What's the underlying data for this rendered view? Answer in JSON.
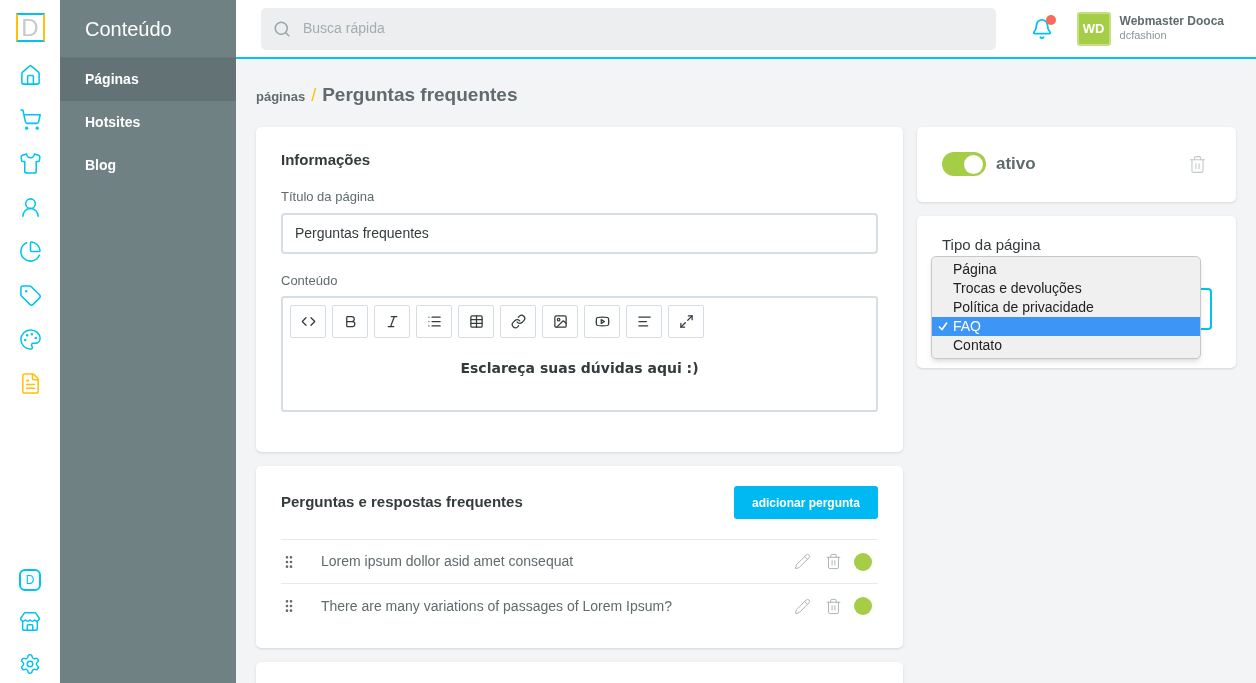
{
  "logo": {
    "letter": "D"
  },
  "rail": {
    "items": [
      {
        "kind": "home",
        "selected": false
      },
      {
        "kind": "cart",
        "selected": false
      },
      {
        "kind": "shirt",
        "selected": false
      },
      {
        "kind": "user",
        "selected": false
      },
      {
        "kind": "chart",
        "selected": false
      },
      {
        "kind": "tag",
        "selected": false
      },
      {
        "kind": "palette",
        "selected": false
      },
      {
        "kind": "document",
        "selected": true
      }
    ],
    "bottom": [
      {
        "kind": "letter",
        "letter": "D"
      },
      {
        "kind": "store"
      },
      {
        "kind": "settings"
      }
    ]
  },
  "sidebar": {
    "title": "Conteúdo",
    "items": [
      {
        "label": "Páginas",
        "selected": true
      },
      {
        "label": "Hotsites",
        "selected": false
      },
      {
        "label": "Blog",
        "selected": false
      }
    ]
  },
  "topbar": {
    "search": {
      "placeholder": "Busca rápida"
    },
    "notifications": {
      "unread": true
    },
    "user": {
      "initials": "WD",
      "name": "Webmaster Dooca",
      "store": "dcfashion"
    }
  },
  "breadcrumb": {
    "parent": "páginas",
    "separator": "/",
    "current": "Perguntas frequentes"
  },
  "info": {
    "title": "Informações",
    "title_label": "Título da página",
    "title_value": "Perguntas frequentes",
    "content_label": "Conteúdo",
    "toolbar": [
      {
        "kind": "code"
      },
      {
        "kind": "bold"
      },
      {
        "kind": "italic"
      },
      {
        "kind": "list"
      },
      {
        "kind": "table"
      },
      {
        "kind": "link"
      },
      {
        "kind": "image"
      },
      {
        "kind": "video"
      },
      {
        "kind": "align"
      },
      {
        "kind": "expand"
      }
    ],
    "content": "Esclareça suas dúvidas aqui :)"
  },
  "faq": {
    "title": "Perguntas e respostas frequentes",
    "add_button": "adicionar pergunta",
    "items": [
      {
        "question": "Lorem ipsum dollor asid amet consequat",
        "color": "#a5cd45"
      },
      {
        "question": "There are many variations of passages of Lorem Ipsum?",
        "color": "#a5cd45"
      }
    ]
  },
  "status": {
    "on": true,
    "label": "ativo"
  },
  "page_type": {
    "label": "Tipo da página",
    "options": [
      {
        "label": "Página",
        "selected": false
      },
      {
        "label": "Trocas e devoluções",
        "selected": false
      },
      {
        "label": "Política de privacidade",
        "selected": false
      },
      {
        "label": "FAQ",
        "selected": true
      },
      {
        "label": "Contato",
        "selected": false
      }
    ]
  }
}
